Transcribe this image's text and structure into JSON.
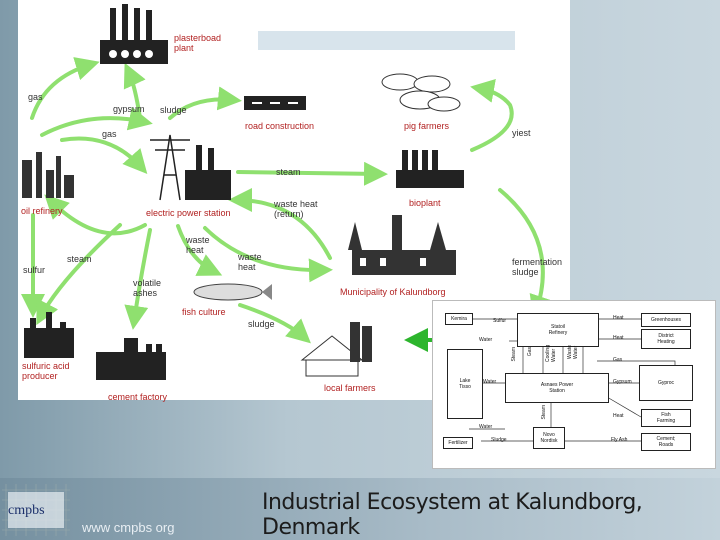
{
  "diagram": {
    "nodes": {
      "plasterboard": "plasterboad\nplant",
      "road": "road construction",
      "pigs": "pig farmers",
      "oil": "oil refinery",
      "power": "electric power station",
      "bioplant": "bioplant",
      "municipality": "Municipality of Kalundborg",
      "fish": "fish culture",
      "sulfuric": "sulfuric acid\nproducer",
      "cement": "cement factory",
      "farmers": "local farmers"
    },
    "flows": {
      "gas_top": "gas",
      "gypsum": "gypsum",
      "sludge_top": "sludge",
      "gas_mid": "gas",
      "yiest": "yiest",
      "steam_power": "steam",
      "waste_heat_return": "waste heat\n(return)",
      "steam_left": "steam",
      "sulfur": "sulfur",
      "waste_heat_a": "waste\nheat",
      "waste_heat_b": "waste\nheat",
      "volatile_ashes": "volatile\nashes",
      "sludge_bottom": "sludge",
      "fermentation": "fermentation\nsludge"
    }
  },
  "inset": {
    "kemira": "Kemira",
    "sulfur": "Sulfur",
    "statoil": "Statoil\nRefinery",
    "heat1": "Heat",
    "greenhouses": "Greenhouses",
    "water": "Water",
    "heat2": "Heat",
    "district": "District\nHeating",
    "gas": "Gas",
    "lake": "Lake\nTisso",
    "water2": "Water",
    "asnaes": "Asnaes Power\nStation",
    "gypsum": "Gypsum",
    "gyproc": "Gyproc",
    "heat3": "Heat",
    "fishfarm": "Fish\nFarming",
    "water3": "Water",
    "novo": "Novo\nNordisk",
    "flyash": "Fly Ash",
    "cement": "Cement;\nRoads",
    "fertilizer": "Fertilizer",
    "sludge": "Sludge",
    "v_steam": "Steam",
    "v_gas": "Gas",
    "v_cooling": "Cooling\nWater",
    "v_waste": "Waste\nWater",
    "v_steam2": "Steam"
  },
  "footer": {
    "title": "Industrial Ecosystem at Kalundborg, Denmark",
    "url": "www cmpbs org",
    "logo": "cmpbs"
  },
  "colors": {
    "arrow": "#8fe06f",
    "node_label": "#b22222",
    "inset_arrow": "#2db52d"
  }
}
